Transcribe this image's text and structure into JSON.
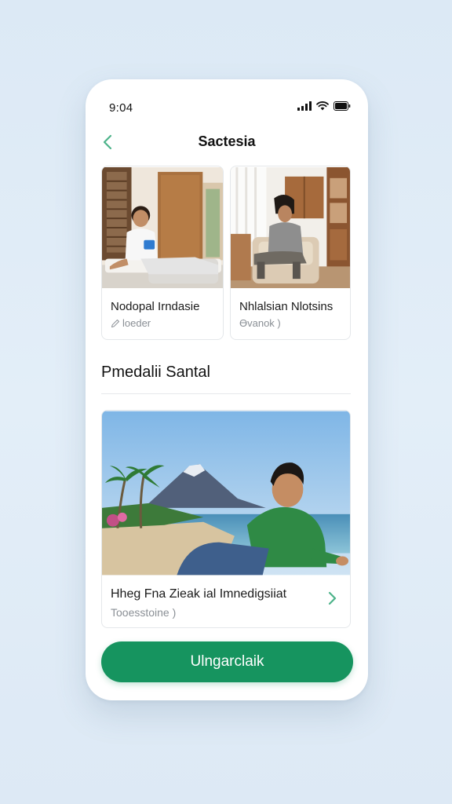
{
  "status_bar": {
    "time": "9:04"
  },
  "nav": {
    "title": "Sactesia"
  },
  "cards": [
    {
      "title": "Nodopal Irndasie",
      "subtitle": "loeder",
      "sub_icon": "pencil-icon"
    },
    {
      "title": "Nhlalsian Nlotsins",
      "subtitle": "Өvanok )",
      "sub_icon": ""
    }
  ],
  "section": {
    "title": "Pmedalii Santal"
  },
  "featured": {
    "title": "Hheg Fna  Zieak ial Imnedigsiiat",
    "subtitle": "Tooesstoine )"
  },
  "cta": {
    "label": "Ulngarclaik"
  },
  "colors": {
    "accent": "#16945f",
    "back_arrow": "#4db38a",
    "background": "#dde9f5"
  }
}
